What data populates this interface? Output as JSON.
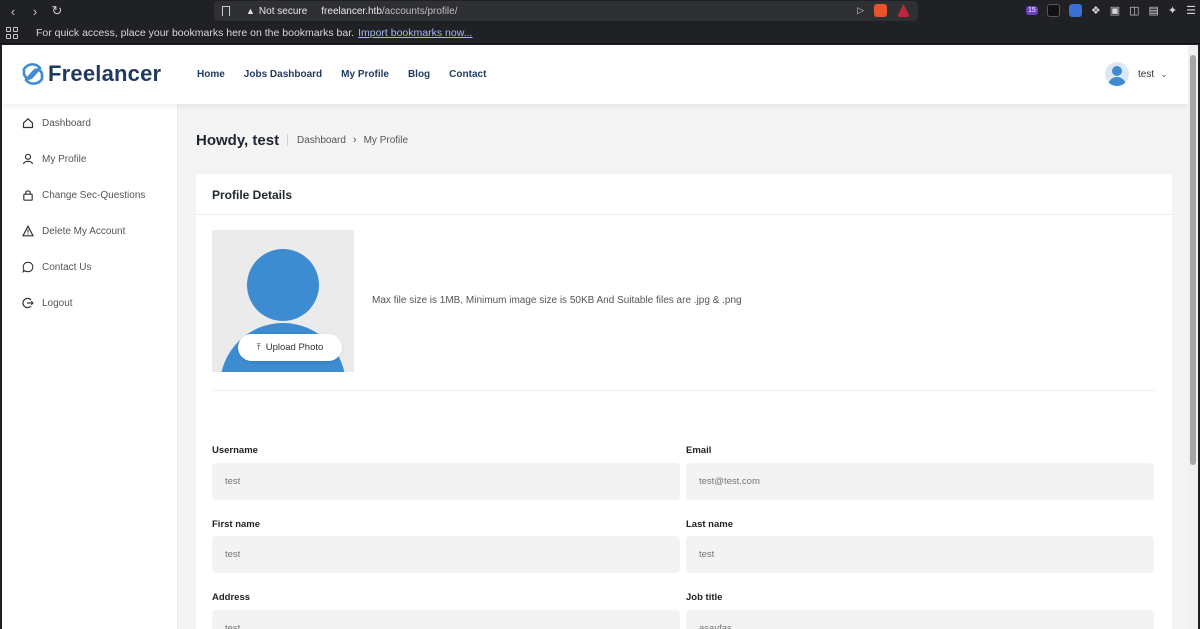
{
  "browser": {
    "security_label": "Not secure",
    "url_host": "freelancer.htb",
    "url_path": "/accounts/profile/",
    "bookmarks_hint": "For quick access, place your bookmarks here on the bookmarks bar.",
    "bookmarks_link": "Import bookmarks now...",
    "extension_badge": "15"
  },
  "header": {
    "logo_text": "Freelancer",
    "nav": [
      "Home",
      "Jobs Dashboard",
      "My Profile",
      "Blog",
      "Contact"
    ],
    "user_name": "test"
  },
  "sidebar": {
    "items": [
      {
        "label": "Dashboard",
        "icon": "home-icon"
      },
      {
        "label": "My Profile",
        "icon": "user-icon"
      },
      {
        "label": "Change Sec-Questions",
        "icon": "lock-icon"
      },
      {
        "label": "Delete My Account",
        "icon": "warning-icon"
      },
      {
        "label": "Contact Us",
        "icon": "chat-icon"
      },
      {
        "label": "Logout",
        "icon": "logout-icon"
      }
    ]
  },
  "page": {
    "greeting": "Howdy, test",
    "breadcrumb": [
      "Dashboard",
      "My Profile"
    ]
  },
  "profile": {
    "card_title": "Profile Details",
    "upload_label": "Upload Photo",
    "file_note": "Max file size is 1MB, Minimum image size is 50KB And Suitable files are .jpg & .png",
    "fields": {
      "username": {
        "label": "Username",
        "value": "test"
      },
      "email": {
        "label": "Email",
        "value": "test@test.com"
      },
      "first_name": {
        "label": "First name",
        "value": "test"
      },
      "last_name": {
        "label": "Last name",
        "value": "test"
      },
      "address": {
        "label": "Address",
        "value": "test"
      },
      "job_title": {
        "label": "Job title",
        "value": "asavfas"
      }
    }
  },
  "colors": {
    "brand": "#1f3a5f",
    "accent": "#3d8bd0"
  }
}
